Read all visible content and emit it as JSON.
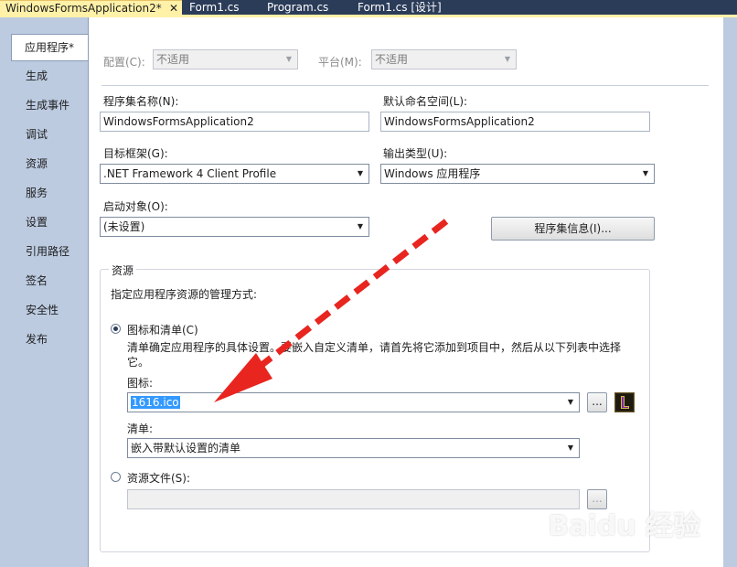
{
  "doc_tabs": [
    {
      "label": "WindowsFormsApplication2*",
      "active": true
    },
    {
      "label": "Form1.cs",
      "active": false
    },
    {
      "label": "Program.cs",
      "active": false
    },
    {
      "label": "Form1.cs [设计]",
      "active": false
    }
  ],
  "close_glyph": "✕",
  "nav_items": [
    {
      "label": "应用程序*",
      "active": true
    },
    {
      "label": "生成"
    },
    {
      "label": "生成事件"
    },
    {
      "label": "调试"
    },
    {
      "label": "资源"
    },
    {
      "label": "服务"
    },
    {
      "label": "设置"
    },
    {
      "label": "引用路径"
    },
    {
      "label": "签名"
    },
    {
      "label": "安全性"
    },
    {
      "label": "发布"
    }
  ],
  "config": {
    "label": "配置(C):",
    "value": "不适用"
  },
  "platform": {
    "label": "平台(M):",
    "value": "不适用"
  },
  "assembly_name": {
    "label": "程序集名称(N):",
    "value": "WindowsFormsApplication2"
  },
  "default_namespace": {
    "label": "默认命名空间(L):",
    "value": "WindowsFormsApplication2"
  },
  "target_framework": {
    "label": "目标框架(G):",
    "value": ".NET Framework 4 Client Profile"
  },
  "output_type": {
    "label": "输出类型(U):",
    "value": "Windows 应用程序"
  },
  "startup_object": {
    "label": "启动对象(O):",
    "value": "(未设置)"
  },
  "assembly_info_button": "程序集信息(I)...",
  "resources": {
    "group_title": "资源",
    "description": "指定应用程序资源的管理方式:",
    "icon_manifest_radio": "图标和清单(C)",
    "icon_manifest_help": "清单确定应用程序的具体设置。要嵌入自定义清单，请首先将它添加到项目中，然后从以下列表中选择它。",
    "icon_label": "图标:",
    "icon_value": "1616.ico",
    "manifest_label": "清单:",
    "manifest_value": "嵌入带默认设置的清单",
    "resource_file_radio": "资源文件(S):",
    "resource_file_value": "",
    "browse_glyph": "..."
  },
  "watermark": {
    "main": "Baidu 经验",
    "sub": "jingyan.baidu.com"
  },
  "colors": {
    "tab_active": "#fff1a8",
    "chrome": "#2b3c59",
    "arrow": "#e8251f"
  }
}
